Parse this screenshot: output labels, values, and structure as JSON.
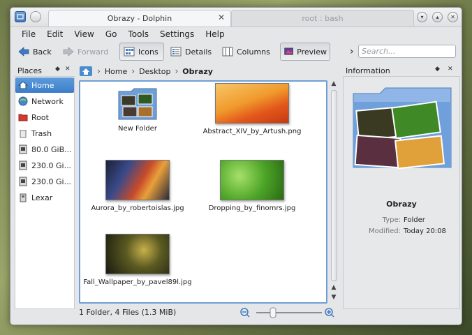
{
  "window": {
    "tabs": [
      {
        "label": "Obrazy - Dolphin",
        "active": true
      },
      {
        "label": "root : bash",
        "active": false
      }
    ],
    "close_glyph": "✕"
  },
  "menu": [
    "File",
    "Edit",
    "View",
    "Go",
    "Tools",
    "Settings",
    "Help"
  ],
  "toolbar": {
    "back": "Back",
    "forward": "Forward",
    "icons": "Icons",
    "details": "Details",
    "columns": "Columns",
    "preview": "Preview",
    "more_glyph": "›",
    "search_placeholder": "Search..."
  },
  "places": {
    "title": "Places",
    "items": [
      {
        "label": "Home",
        "icon": "home-icon",
        "selected": true
      },
      {
        "label": "Network",
        "icon": "network-icon",
        "selected": false
      },
      {
        "label": "Root",
        "icon": "folder-red-icon",
        "selected": false
      },
      {
        "label": "Trash",
        "icon": "trash-icon",
        "selected": false
      },
      {
        "label": "80.0 GiB...",
        "icon": "drive-icon",
        "selected": false
      },
      {
        "label": "230.0 Gi...",
        "icon": "drive-icon",
        "selected": false
      },
      {
        "label": "230.0 Gi...",
        "icon": "drive-icon",
        "selected": false
      },
      {
        "label": "Lexar",
        "icon": "usb-drive-icon",
        "selected": false
      }
    ]
  },
  "breadcrumb": [
    "Home",
    "Desktop",
    "Obrazy"
  ],
  "files": [
    {
      "name": "New Folder",
      "kind": "folder"
    },
    {
      "name": "Abstract_XIV_by_Artush.png",
      "kind": "image-orange"
    },
    {
      "name": "Aurora_by_robertoislas.jpg",
      "kind": "image-aurora"
    },
    {
      "name": "Dropping_by_finomrs.jpg",
      "kind": "image-green"
    },
    {
      "name": "Fall_Wallpaper_by_pavel89l.jpg",
      "kind": "image-dark"
    }
  ],
  "status": "1 Folder, 4 Files (1.3 MiB)",
  "information": {
    "title": "Information",
    "name": "Obrazy",
    "type_label": "Type:",
    "type_value": "Folder",
    "modified_label": "Modified:",
    "modified_value": "Today 20:08"
  },
  "colors": {
    "selection": "#3d7ec9",
    "view_border": "#6f9fd6"
  }
}
